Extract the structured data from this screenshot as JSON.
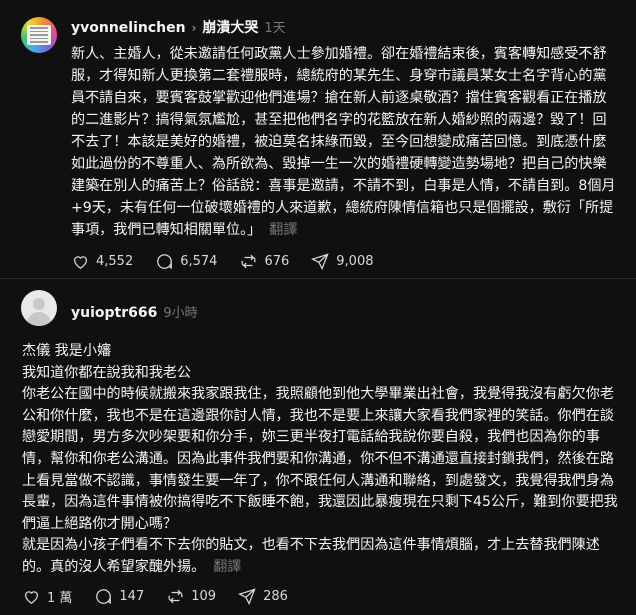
{
  "post1": {
    "username": "yvonnelinchen",
    "topic": "崩潰大哭",
    "time": "1天",
    "body": "新人、主婚人，從未邀請任何政黨人士參加婚禮。卻在婚禮結束後，賓客轉知感受不舒服，才得知新人更換第二套禮服時，總統府的某先生、身穿市議員某女士名字背心的黨員不請自來，要賓客鼓掌歡迎他們進場？搶在新人前逐桌敬酒？擋住賓客觀看正在播放的二進影片？搞得氣氛尷尬，甚至把他們名字的花籃放在新人婚紗照的兩邊？毀了！回不去了！本該是美好的婚禮，被迫莫名抹綠而毀，至今回想變成痛苦回憶。到底憑什麼如此過份的不尊重人、為所欲為、毀掉一生一次的婚禮硬轉變造勢場地？把自己的快樂建築在別人的痛苦上？俗話說：喜事是邀請，不請不到，白事是人情，不請自到。8個月+9天，未有任何一位破壞婚禮的人來道歉，總統府陳情信箱也只是個擺設，敷衍「所提事項，我們已轉知相關單位。」",
    "translate": "翻譯",
    "likes": "4,552",
    "comments": "6,574",
    "reposts": "676",
    "shares": "9,008"
  },
  "post2": {
    "username": "yuioptr666",
    "time": "9小時",
    "lines": [
      "杰儀 我是小嬸",
      "我知道你都在說我和我老公",
      "你老公在國中的時候就搬來我家跟我住，我照顧他到他大學畢業出社會，我覺得我沒有虧欠你老公和你什麼，我也不是在這邊跟你討人情，我也不是要上來讓大家看我們家裡的笑話。你們在談戀愛期間，男方多次吵架要和你分手，妳三更半夜打電話給我說你要自殺，我們也因為你的事情，幫你和你老公溝通。因為此事件我們要和你溝通，你不但不溝通還直接封鎖我們，然後在路上看見當做不認識，事情發生要一年了，你不跟任何人溝通和聯絡，到處發文，我覺得我們身為長輩，因為這件事情被你搞得吃不下飯睡不飽，我還因此暴瘦現在只剩下45公斤，難到你要把我們逼上絕路你才開心嗎？",
      "就是因為小孩子們看不下去你的貼文，也看不下去我們因為這件事情煩腦，才上去替我們陳述的。真的沒人希望家醜外揚。"
    ],
    "translate": "翻譯",
    "likes": "1 萬",
    "comments": "147",
    "reposts": "109",
    "shares": "286"
  }
}
